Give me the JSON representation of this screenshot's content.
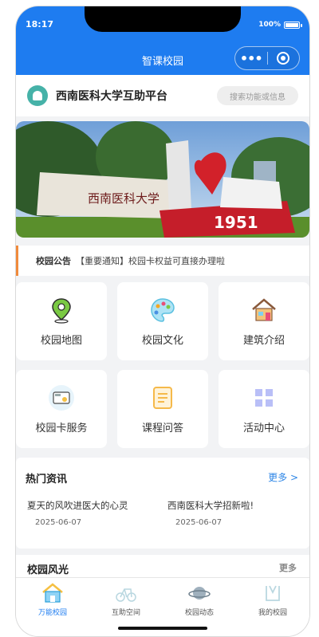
{
  "status": {
    "time": "18:17",
    "battery": "100%"
  },
  "nav": {
    "title": "智课校园",
    "more_label": "•••"
  },
  "header": {
    "platform_name": "西南医科大学互助平台",
    "search_placeholder": "搜索功能或信息"
  },
  "banner": {
    "sign_text": "西南医科大学",
    "year": "1951"
  },
  "notice": {
    "label": "校园公告",
    "text": "【重要通知】校园卡权益可直接办理啦"
  },
  "grid": [
    {
      "label": "校园地图",
      "icon": "map-pin-icon"
    },
    {
      "label": "校园文化",
      "icon": "palette-icon"
    },
    {
      "label": "建筑介绍",
      "icon": "house-icon"
    },
    {
      "label": "校园卡服务",
      "icon": "campus-card-icon"
    },
    {
      "label": "课程问答",
      "icon": "document-icon"
    },
    {
      "label": "活动中心",
      "icon": "grid-icon"
    }
  ],
  "news": {
    "title": "热门资讯",
    "more": "更多 >",
    "items": [
      {
        "title": "夏天的风吹进医大的心灵",
        "date": "2025-06-07"
      },
      {
        "title": "西南医科大学招新啦!",
        "date": "2025-06-07"
      }
    ]
  },
  "scenery": {
    "title": "校园风光",
    "more": "更多"
  },
  "tabs": [
    {
      "label": "万能校园",
      "icon": "home-icon",
      "active": true
    },
    {
      "label": "互助空间",
      "icon": "bicycle-icon",
      "active": false
    },
    {
      "label": "校园动态",
      "icon": "planet-icon",
      "active": false
    },
    {
      "label": "我的校园",
      "icon": "profile-icon",
      "active": false
    }
  ],
  "colors": {
    "primary": "#1e7cf0",
    "notice_accent": "#f08a3c",
    "link": "#2e86e6"
  }
}
